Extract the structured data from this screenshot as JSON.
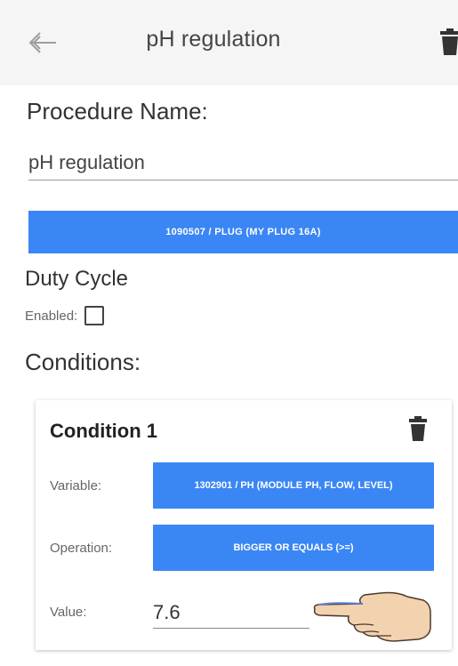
{
  "header": {
    "title": "pH regulation",
    "back_icon": "back-arrow-icon",
    "delete_icon": "trash-icon"
  },
  "procedure": {
    "label": "Procedure Name:",
    "name_value": "pH regulation",
    "plug_button": "1090507 / PLUG (MY PLUG 16A)"
  },
  "duty_cycle": {
    "label": "Duty Cycle",
    "enabled_label": "Enabled:",
    "enabled": false
  },
  "conditions": {
    "label": "Conditions:",
    "items": [
      {
        "title": "Condition 1",
        "variable_label": "Variable:",
        "variable_value": "1302901 / PH (MODULE PH, FLOW, LEVEL)",
        "operation_label": "Operation:",
        "operation_value": "BIGGER OR EQUALS (>=)",
        "value_label": "Value:",
        "value": "7.6"
      }
    ]
  },
  "colors": {
    "accent": "#3b86f5",
    "topbar_bg": "#f5f5f5"
  }
}
